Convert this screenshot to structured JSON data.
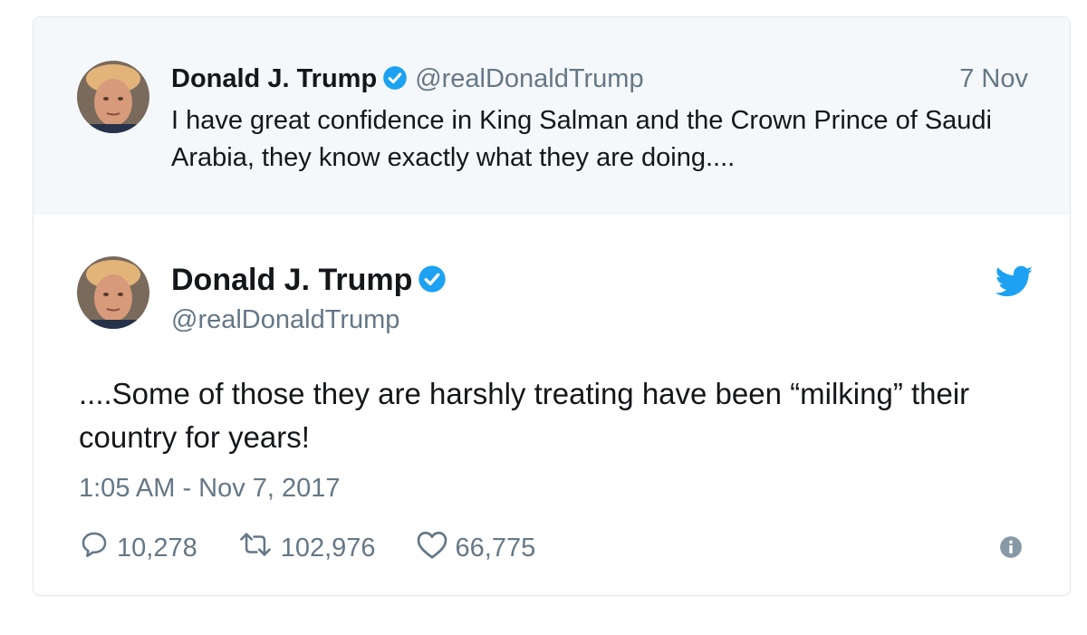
{
  "parent_tweet": {
    "name": "Donald J. Trump",
    "handle": "@realDonaldTrump",
    "date": "7 Nov",
    "text": "I have great confidence in King Salman and the Crown Prince of Saudi Arabia, they know exactly what they are doing...."
  },
  "main_tweet": {
    "name": "Donald J. Trump",
    "handle": "@realDonaldTrump",
    "text": "....Some of those they are harshly treating have been “milking” their country for years!",
    "timestamp": "1:05 AM - Nov 7, 2017",
    "replies": "10,278",
    "retweets": "102,976",
    "likes": "66,775"
  },
  "icons": {
    "verified": "verified-badge-icon",
    "brand": "twitter-bird-icon",
    "reply": "reply-icon",
    "retweet": "retweet-icon",
    "like": "heart-icon",
    "info": "info-icon"
  },
  "colors": {
    "twitter_blue": "#1da1f2",
    "secondary_text": "#657786",
    "parent_background": "#f5f8fa",
    "border": "#e1e8ed"
  }
}
